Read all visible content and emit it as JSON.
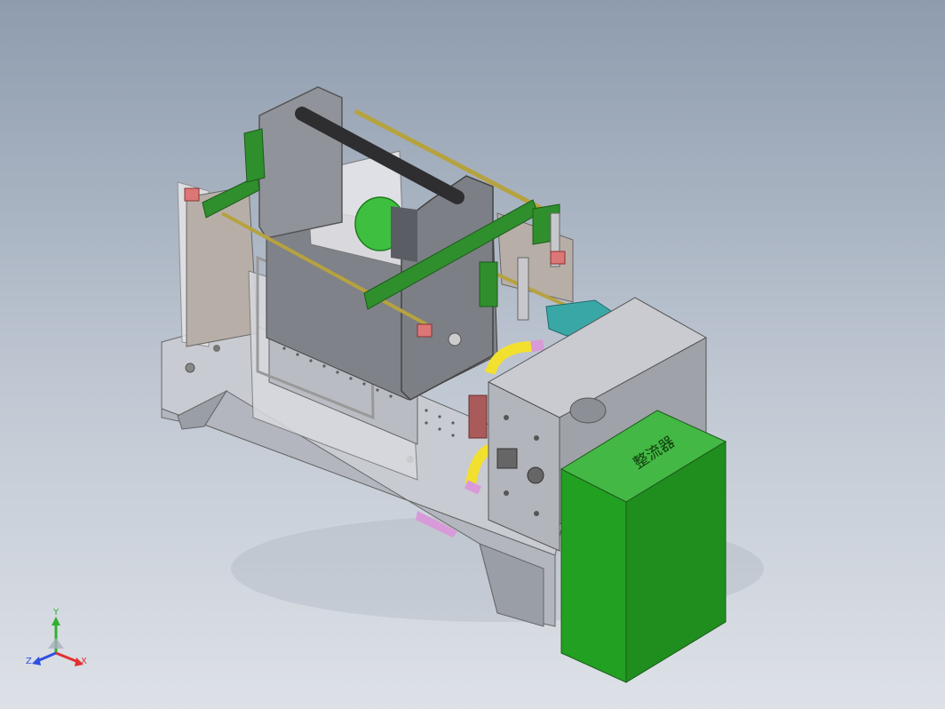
{
  "viewport": {
    "background_top": "#8e9cae",
    "background_bottom": "#dde1e7"
  },
  "model": {
    "label_on_box": "整流器",
    "colors": {
      "base": "#c9cbd2",
      "panel": "#b7afa7",
      "plate": "#7f8288",
      "green": "#2f8f2c",
      "green_box": "#22a022",
      "rod": "#b6a23f",
      "yellow_hose": "#f2e02e",
      "pink_hose": "#d89ad8",
      "teal": "#3aa7a7",
      "motor": "#3fbf3f"
    }
  },
  "triad": {
    "y_label": "Y",
    "x_label": "X",
    "z_label": "Z",
    "x_color": "#e33030",
    "y_color": "#30b030",
    "z_color": "#3050e0"
  }
}
